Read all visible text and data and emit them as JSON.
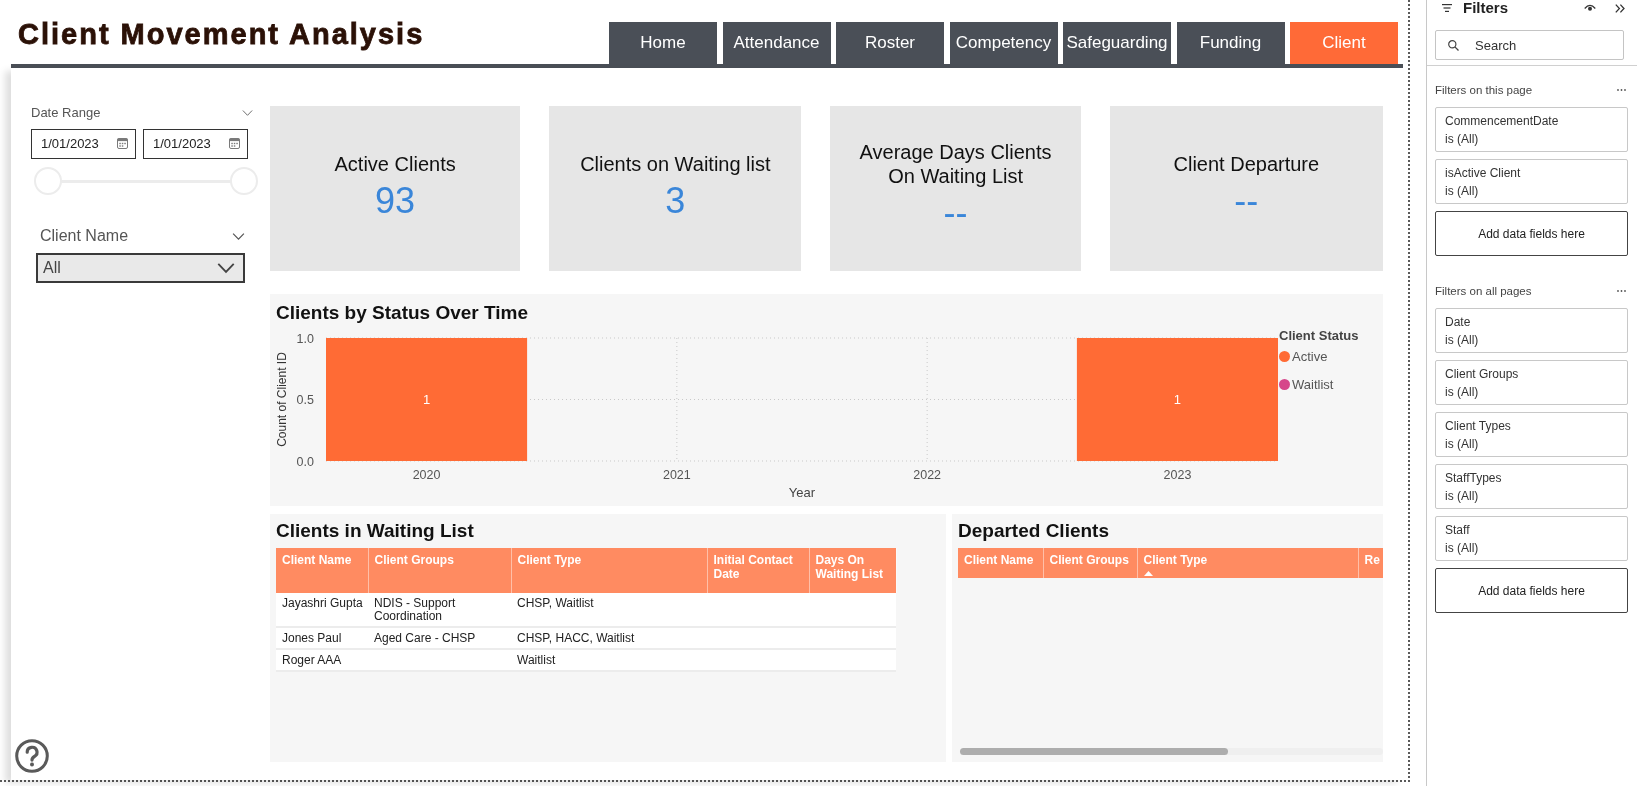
{
  "header": {
    "title": "Client Movement Analysis"
  },
  "tabs": [
    {
      "label": "Home",
      "selected": false
    },
    {
      "label": "Attendance",
      "selected": false
    },
    {
      "label": "Roster",
      "selected": false
    },
    {
      "label": "Competency",
      "selected": false
    },
    {
      "label": "Safeguarding",
      "selected": false
    },
    {
      "label": "Funding",
      "selected": false
    },
    {
      "label": "Client",
      "selected": true
    }
  ],
  "date_slicer": {
    "label": "Date Range",
    "start": "1/01/2023",
    "end": "1/01/2023",
    "handles": [
      {
        "level": 0
      },
      {
        "level": 1
      }
    ]
  },
  "client_slicer": {
    "label": "Client Name",
    "value": "All"
  },
  "kpis": [
    {
      "label": "Active Clients",
      "value": "93"
    },
    {
      "label": "Clients on Waiting list",
      "value": "3"
    },
    {
      "label": "Average Days Clients On Waiting List",
      "value": "--"
    },
    {
      "label": "Client Departure",
      "value": "--"
    }
  ],
  "chart": {
    "legend_title": "Client Status",
    "chart_data": {
      "type": "bar",
      "title": "Clients by Status Over Time",
      "xlabel": "Year",
      "ylabel": "Count of Client ID",
      "categories": [
        "2020",
        "2021",
        "2022",
        "2023"
      ],
      "series": [
        {
          "name": "Active",
          "color": "#ff6b35",
          "values": [
            1,
            null,
            null,
            1
          ]
        },
        {
          "name": "Waitlist",
          "color": "#d6468a",
          "values": [
            null,
            null,
            null,
            null
          ]
        }
      ],
      "ylim": [
        0,
        1
      ],
      "yticks": [
        {
          "value": 0,
          "label": "0.0"
        },
        {
          "value": 0.5,
          "label": "0.5"
        },
        {
          "value": 1,
          "label": "1.0"
        }
      ],
      "stacked": true,
      "data_labels": true,
      "grid": true
    }
  },
  "waiting_list": {
    "title": "Clients in Waiting List",
    "columns": [
      "Client Name",
      "Client Groups",
      "Client Type",
      "Initial Contact Date",
      "Days On Waiting List"
    ],
    "rows": [
      {
        "cells": [
          "Jayashri Gupta",
          "NDIS - Support Coordination",
          "CHSP, Waitlist"
        ]
      },
      {
        "cells": [
          "Jones Paul",
          "Aged Care - CHSP",
          "CHSP, HACC, Waitlist"
        ]
      },
      {
        "cells": [
          "Roger AAA",
          null,
          "Waitlist"
        ]
      }
    ]
  },
  "departed_clients": {
    "title": "Departed Clients",
    "columns": [
      {
        "label": "Client Name",
        "sorted": false
      },
      {
        "label": "Client Groups",
        "sorted": false
      },
      {
        "label": "Client Type",
        "sorted": true
      },
      {
        "label": "Re",
        "sorted": false
      }
    ]
  },
  "filters_pane": {
    "title": "Filters",
    "search": {
      "placeholder": "Search"
    },
    "sections": [
      {
        "title": "Filters on this page",
        "filters": [
          {
            "name": "CommencementDate",
            "value": "is (All)"
          },
          {
            "name": "isActive Client",
            "value": "is (All)"
          }
        ],
        "add_label": "Add data fields here"
      },
      {
        "title": "Filters on all pages",
        "filters": [
          {
            "name": "Date",
            "value": "is (All)"
          },
          {
            "name": "Client Groups",
            "value": "is (All)"
          },
          {
            "name": "Client Types",
            "value": "is (All)"
          },
          {
            "name": "StaffTypes",
            "value": "is (All)"
          },
          {
            "name": "Staff",
            "value": "is (All)"
          }
        ],
        "add_label": "Add data fields here"
      }
    ]
  }
}
